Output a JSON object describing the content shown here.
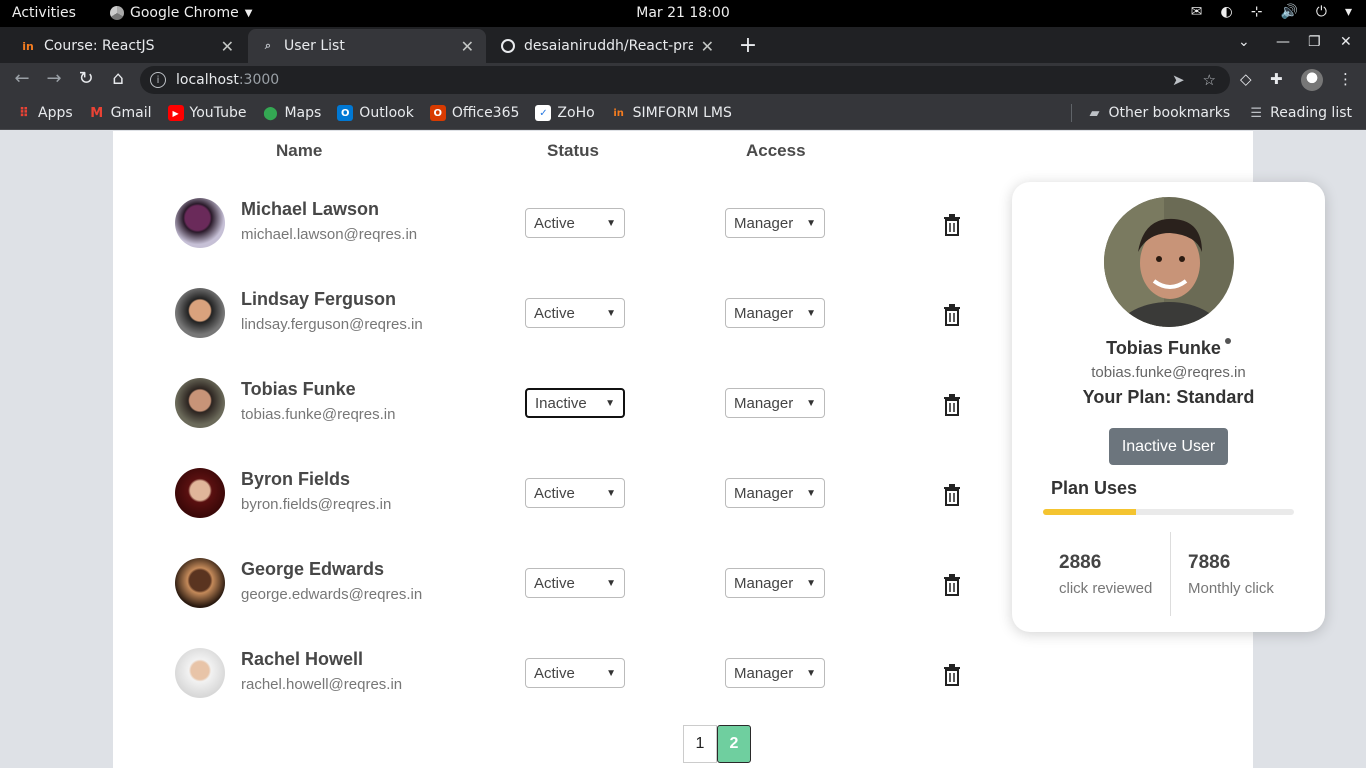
{
  "os_bar": {
    "activities": "Activities",
    "app_name": "Google Chrome",
    "clock": "Mar 21  18:00"
  },
  "tabs": [
    {
      "title": "Course: ReactJS"
    },
    {
      "title": "User List"
    },
    {
      "title": "desaianiruddh/React-prac"
    }
  ],
  "address_bar": {
    "host": "localhost",
    "port": ":3000"
  },
  "bookmarks": [
    {
      "label": "Apps"
    },
    {
      "label": "Gmail"
    },
    {
      "label": "YouTube"
    },
    {
      "label": "Maps"
    },
    {
      "label": "Outlook"
    },
    {
      "label": "Office365"
    },
    {
      "label": "ZoHo"
    },
    {
      "label": "SIMFORM LMS"
    }
  ],
  "bookmarks_right": {
    "other": "Other bookmarks",
    "reading": "Reading list"
  },
  "table": {
    "headers": {
      "name": "Name",
      "status": "Status",
      "access": "Access"
    },
    "rows": [
      {
        "name": "Michael Lawson",
        "email": "michael.lawson@reqres.in",
        "status": "Active",
        "access": "Manager"
      },
      {
        "name": "Lindsay Ferguson",
        "email": "lindsay.ferguson@reqres.in",
        "status": "Active",
        "access": "Manager"
      },
      {
        "name": "Tobias Funke",
        "email": "tobias.funke@reqres.in",
        "status": "Inactive",
        "access": "Manager"
      },
      {
        "name": "Byron Fields",
        "email": "byron.fields@reqres.in",
        "status": "Active",
        "access": "Manager"
      },
      {
        "name": "George Edwards",
        "email": "george.edwards@reqres.in",
        "status": "Active",
        "access": "Manager"
      },
      {
        "name": "Rachel Howell",
        "email": "rachel.howell@reqres.in",
        "status": "Active",
        "access": "Manager"
      }
    ]
  },
  "pagination": {
    "pages": [
      "1",
      "2"
    ],
    "current": "2"
  },
  "profile_card": {
    "name": "Tobias Funke",
    "email": "tobias.funke@reqres.in",
    "plan": "Your Plan: Standard",
    "button": "Inactive User",
    "uses_label": "Plan Uses",
    "usage_fraction": 0.37,
    "stat1_value": "2886",
    "stat1_label": "click reviewed",
    "stat2_value": "7886",
    "stat2_label": "Monthly click"
  },
  "colors": {
    "accent_green": "#6fcf9f",
    "usage_bar": "#f4c430",
    "button_gray": "#6c757d"
  }
}
